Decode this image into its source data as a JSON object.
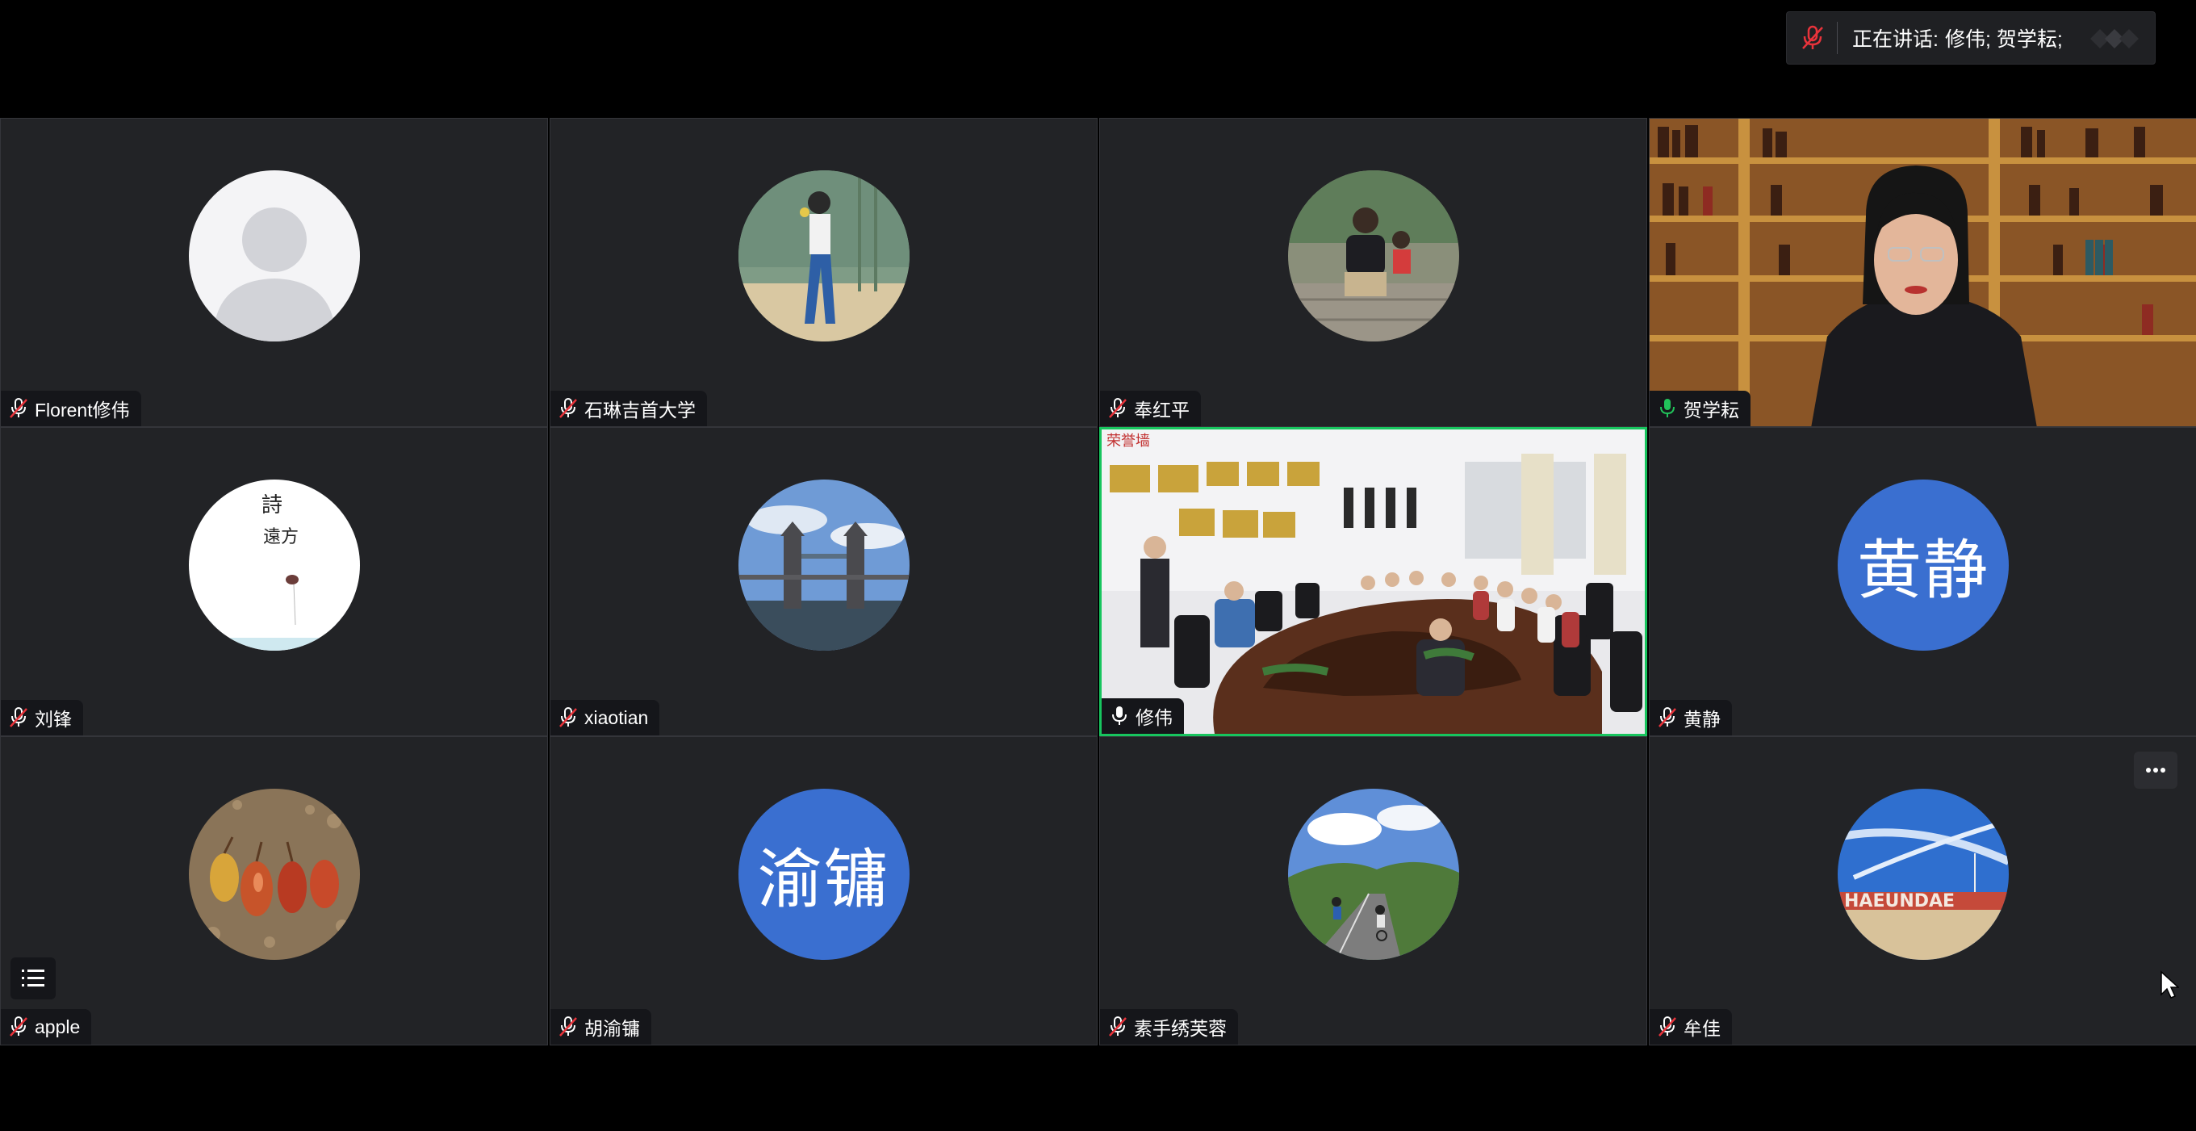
{
  "speaking_bar": {
    "label": "正在讲话:",
    "names": "修伟; 贺学耘;"
  },
  "participants": [
    {
      "name": "Florent修伟",
      "muted": true,
      "avatar": "default-person"
    },
    {
      "name": "石琳吉首大学",
      "muted": true,
      "avatar": "photo-girl-painting"
    },
    {
      "name": "奉红平",
      "muted": true,
      "avatar": "photo-family"
    },
    {
      "name": "贺学耘",
      "muted": false,
      "avatar": "video-bookshelf-speaker"
    },
    {
      "name": "刘锋",
      "muted": true,
      "avatar": "photo-calligraphy"
    },
    {
      "name": "xiaotian",
      "muted": true,
      "avatar": "photo-tower-bridge"
    },
    {
      "name": "修伟",
      "muted": false,
      "avatar": "video-conference-room",
      "active": true
    },
    {
      "name": "黄静",
      "muted": true,
      "avatar": "initials",
      "initials": "黄静"
    },
    {
      "name": "apple",
      "muted": true,
      "avatar": "photo-seeds"
    },
    {
      "name": "胡渝镛",
      "muted": true,
      "avatar": "initials",
      "initials": "渝镛"
    },
    {
      "name": "素手绣芙蓉",
      "muted": true,
      "avatar": "photo-cycling-road"
    },
    {
      "name": "牟佳",
      "muted": true,
      "avatar": "photo-beach-sky"
    }
  ],
  "colors": {
    "active_speaker_border": "#17c55e",
    "tile_background": "#222326",
    "initials_avatar": "#3a6fd0",
    "muted_mic": "#e8333b",
    "unmuted_mic": "#21c35a"
  }
}
